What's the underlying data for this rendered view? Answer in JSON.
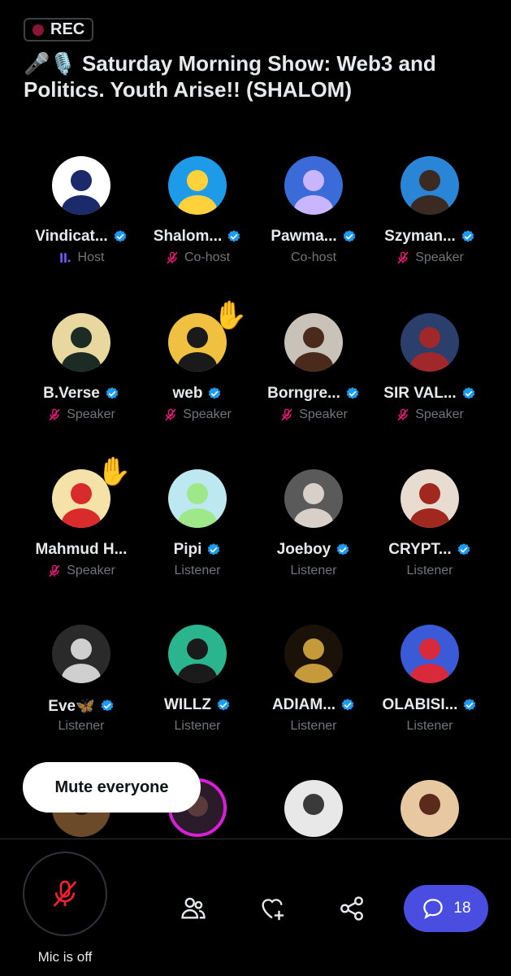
{
  "recording": {
    "label": "REC",
    "dot_color": "#8b1538"
  },
  "title": "🎤🎙️ Saturday Morning Show: Web3 and Politics. Youth Arise!! (SHALOM)",
  "participants": [
    {
      "name": "Vindicat...",
      "verified": true,
      "role": "Host",
      "role_icon": "speaking-bars-icon",
      "hand_raised": false
    },
    {
      "name": "Shalom...",
      "verified": true,
      "role": "Co-host",
      "role_icon": "mic-off-icon",
      "hand_raised": false
    },
    {
      "name": "Pawma...",
      "verified": true,
      "role": "Co-host",
      "role_icon": "none",
      "hand_raised": false
    },
    {
      "name": "Szyman...",
      "verified": true,
      "role": "Speaker",
      "role_icon": "mic-off-icon",
      "hand_raised": false
    },
    {
      "name": "B.Verse",
      "verified": true,
      "role": "Speaker",
      "role_icon": "mic-off-icon",
      "hand_raised": false
    },
    {
      "name": "web",
      "verified": true,
      "role": "Speaker",
      "role_icon": "mic-off-icon",
      "hand_raised": true
    },
    {
      "name": "Borngre...",
      "verified": true,
      "role": "Speaker",
      "role_icon": "mic-off-icon",
      "hand_raised": false
    },
    {
      "name": "SIR VAL...",
      "verified": true,
      "role": "Speaker",
      "role_icon": "mic-off-icon",
      "hand_raised": false
    },
    {
      "name": "Mahmud H...",
      "verified": false,
      "role": "Speaker",
      "role_icon": "mic-off-icon",
      "hand_raised": true
    },
    {
      "name": "Pipi",
      "verified": true,
      "role": "Listener",
      "role_icon": "none",
      "hand_raised": false
    },
    {
      "name": "Joeboy",
      "verified": true,
      "role": "Listener",
      "role_icon": "none",
      "hand_raised": false
    },
    {
      "name": "CRYPT...",
      "verified": true,
      "role": "Listener",
      "role_icon": "none",
      "hand_raised": false
    },
    {
      "name": "Eve🦋",
      "verified": true,
      "role": "Listener",
      "role_icon": "none",
      "hand_raised": false
    },
    {
      "name": "WILLZ",
      "verified": true,
      "role": "Listener",
      "role_icon": "none",
      "hand_raised": false
    },
    {
      "name": "ADIAM...",
      "verified": true,
      "role": "Listener",
      "role_icon": "none",
      "hand_raised": false
    },
    {
      "name": "OLABISI...",
      "verified": true,
      "role": "Listener",
      "role_icon": "none",
      "hand_raised": false
    }
  ],
  "toast": {
    "label": "Mute everyone"
  },
  "bottom_bar": {
    "mic_label": "Mic is off",
    "chat_count": "18",
    "icons": [
      "people-icon",
      "heart-plus-icon",
      "share-icon",
      "chat-icon"
    ]
  },
  "colors": {
    "verified": "#1d9bf0",
    "mic_off": "#f91880",
    "host_bars": "#7856ff",
    "chat_button": "#4a4ee0"
  }
}
